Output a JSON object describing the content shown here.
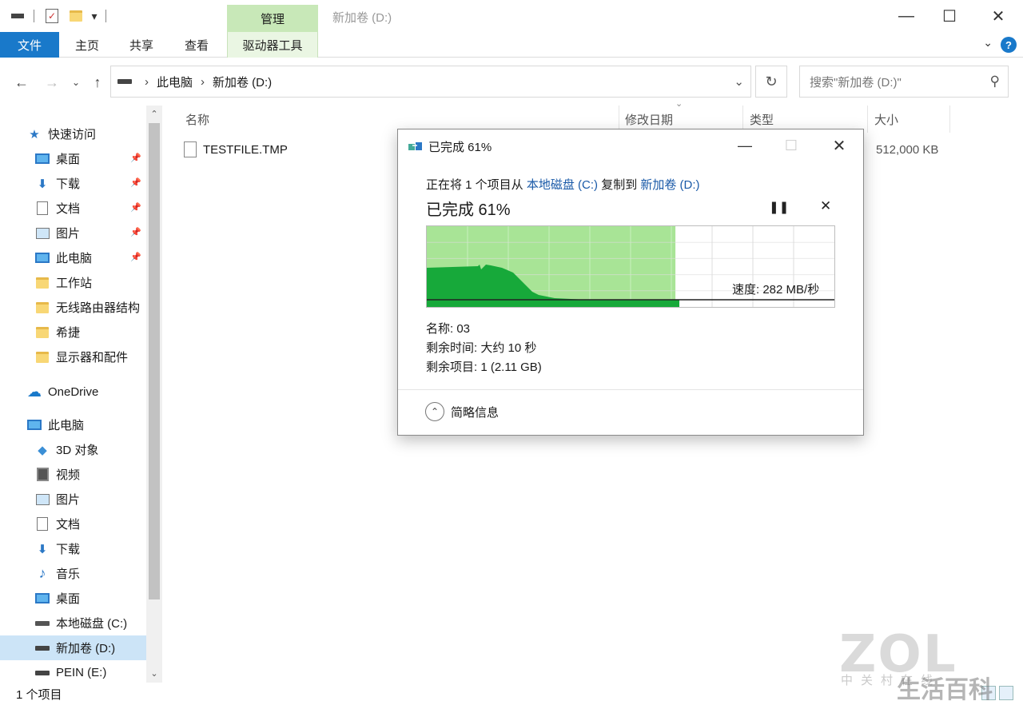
{
  "titlebar": {
    "context_tab": "管理",
    "window_title": "新加卷 (D:)",
    "minimize": "—",
    "maximize": "☐",
    "close": "✕"
  },
  "ribbon": {
    "tabs": [
      "文件",
      "主页",
      "共享",
      "查看",
      "驱动器工具"
    ],
    "help": "?"
  },
  "nav": {
    "path": [
      "此电脑",
      "新加卷 (D:)"
    ],
    "search_placeholder": "搜索\"新加卷 (D:)\""
  },
  "sidebar": {
    "quick_access": "快速访问",
    "pinned": [
      "桌面",
      "下载",
      "文档",
      "图片",
      "此电脑"
    ],
    "folders": [
      "工作站",
      "无线路由器结构",
      "希捷",
      "显示器和配件"
    ],
    "onedrive": "OneDrive",
    "this_pc": "此电脑",
    "pc_items": [
      "3D 对象",
      "视频",
      "图片",
      "文档",
      "下载",
      "音乐",
      "桌面",
      "本地磁盘 (C:)",
      "新加卷 (D:)",
      "PEIN (E:)"
    ]
  },
  "columns": {
    "name": "名称",
    "date": "修改日期",
    "type": "类型",
    "size": "大小"
  },
  "files": [
    {
      "name": "TESTFILE.TMP",
      "size": "512,000 KB"
    }
  ],
  "status": {
    "count": "1 个项目"
  },
  "dialog": {
    "title": "已完成 61%",
    "line_prefix": "正在将 1 个项目从 ",
    "source": "本地磁盘 (C:)",
    "line_mid": " 复制到 ",
    "dest": "新加卷 (D:)",
    "progress_text": "已完成 61%",
    "progress_percent": 61,
    "speed": "速度: 282 MB/秒",
    "name_line": "名称: 03",
    "time_line": "剩余时间: 大约 10 秒",
    "items_line": "剩余项目: 1 (2.11 GB)",
    "less_details": "简略信息",
    "pause": "❚❚",
    "cancel": "✕"
  },
  "watermark": {
    "logo": "ZOL",
    "sub": "中关村在线",
    "cn": "生活百科"
  },
  "colors": {
    "accent": "#1979ca",
    "progress_fill": "#a8e496",
    "graph_area": "#17a93a"
  }
}
